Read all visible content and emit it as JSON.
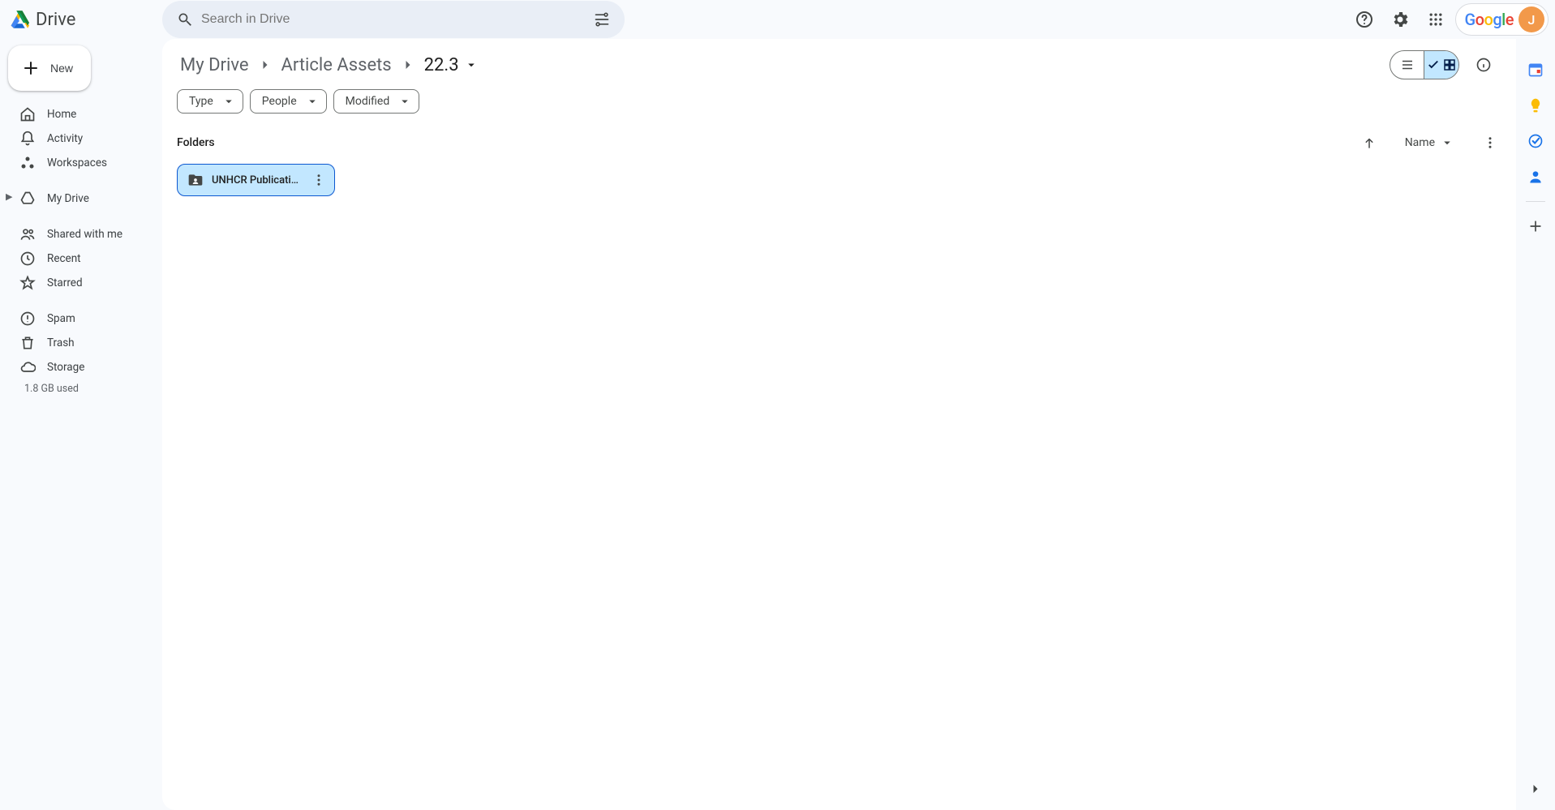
{
  "brand": {
    "name": "Drive"
  },
  "search": {
    "placeholder": "Search in Drive"
  },
  "account": {
    "avatar_initial": "J"
  },
  "newButton": {
    "label": "New"
  },
  "sidebar": {
    "group_primary": [
      {
        "label": "Home"
      },
      {
        "label": "Activity"
      },
      {
        "label": "Workspaces"
      }
    ],
    "group_locations": [
      {
        "label": "My Drive",
        "expandable": true
      },
      {
        "label": "Shared with me"
      },
      {
        "label": "Recent"
      },
      {
        "label": "Starred"
      }
    ],
    "group_utility": [
      {
        "label": "Spam"
      },
      {
        "label": "Trash"
      },
      {
        "label": "Storage"
      }
    ],
    "storage_used": "1.8 GB used"
  },
  "breadcrumb": {
    "parts": [
      {
        "label": "My Drive"
      },
      {
        "label": "Article Assets"
      },
      {
        "label": "22.3",
        "current": true
      }
    ]
  },
  "filters": [
    {
      "label": "Type"
    },
    {
      "label": "People"
    },
    {
      "label": "Modified"
    }
  ],
  "section": {
    "heading": "Folders"
  },
  "sort": {
    "label": "Name"
  },
  "folders": [
    {
      "name": "UNHCR Publication …"
    }
  ]
}
